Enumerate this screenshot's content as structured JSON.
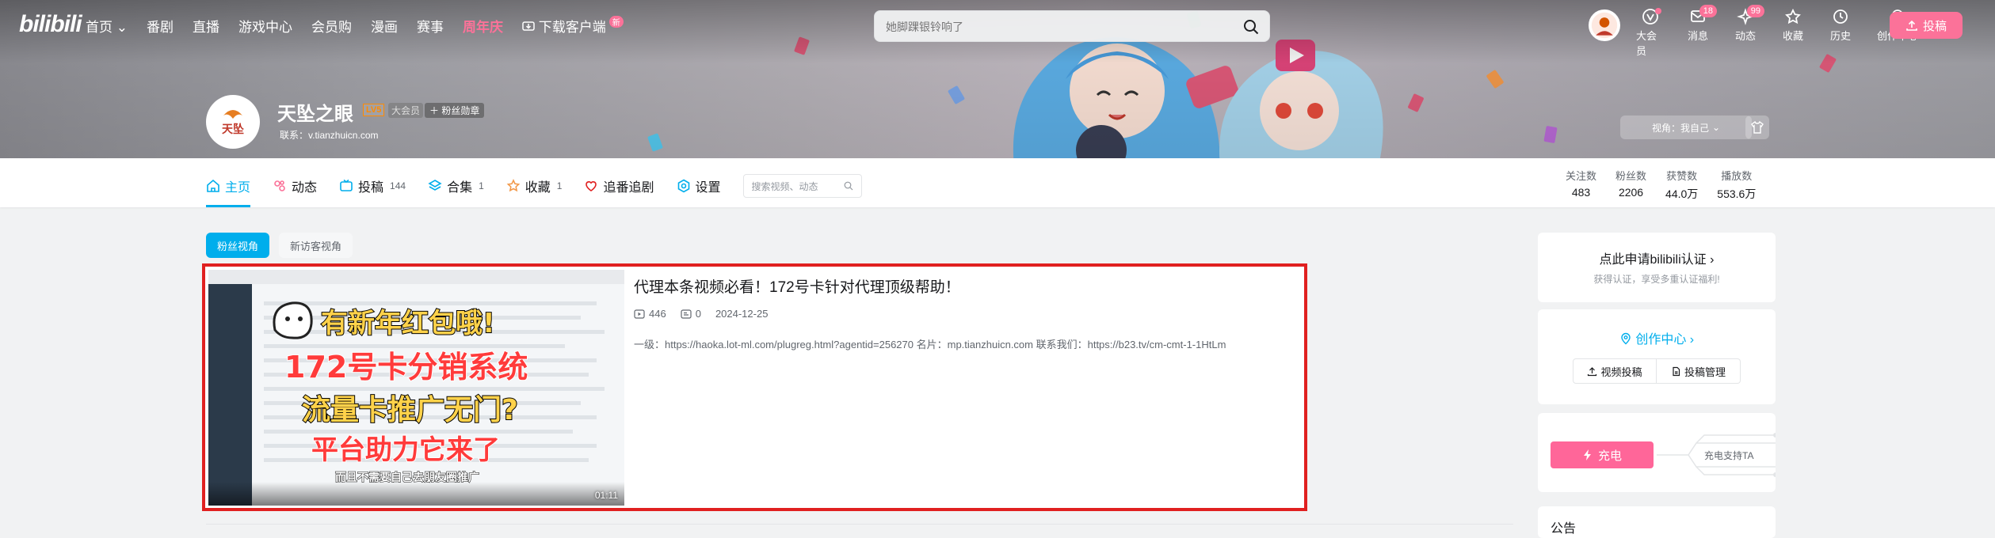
{
  "nav": {
    "logo": "bilibili",
    "items": [
      "首页",
      "番剧",
      "直播",
      "游戏中心",
      "会员购",
      "漫画",
      "赛事"
    ],
    "highlight": "周年庆",
    "download": "下载客户端",
    "download_badge": "新",
    "search_placeholder": "她脚踝银铃响了",
    "right": [
      {
        "label": "大会员",
        "icon": "vip-icon"
      },
      {
        "label": "消息",
        "icon": "message-icon",
        "badge": "18"
      },
      {
        "label": "动态",
        "icon": "dynamic-icon",
        "badge": "99"
      },
      {
        "label": "收藏",
        "icon": "star-icon"
      },
      {
        "label": "历史",
        "icon": "history-icon"
      },
      {
        "label": "创作中心",
        "icon": "bulb-icon"
      }
    ],
    "upload": "投稿"
  },
  "profile": {
    "avatar_text": "天坠",
    "name": "天坠之眼",
    "level": "LV5",
    "vip": "大会员",
    "fans_medal": "粉丝勋章",
    "sign": "联系：v.tianzhuicn.com",
    "view_as": "视角：我自己"
  },
  "tabs": [
    {
      "label": "主页",
      "count": "",
      "icon": "home-icon"
    },
    {
      "label": "动态",
      "count": "",
      "icon": "dynamic-icon"
    },
    {
      "label": "投稿",
      "count": "144",
      "icon": "tv-icon"
    },
    {
      "label": "合集",
      "count": "1",
      "icon": "layers-icon"
    },
    {
      "label": "收藏",
      "count": "1",
      "icon": "star-icon"
    },
    {
      "label": "追番追剧",
      "count": "",
      "icon": "heart-icon"
    },
    {
      "label": "设置",
      "count": "",
      "icon": "settings-icon"
    }
  ],
  "tab_search_placeholder": "搜索视频、动态",
  "stats": [
    {
      "label": "关注数",
      "value": "483"
    },
    {
      "label": "粉丝数",
      "value": "2206"
    },
    {
      "label": "获赞数",
      "value": "44.0万"
    },
    {
      "label": "播放数",
      "value": "553.6万"
    }
  ],
  "view_tabs": [
    "粉丝视角",
    "新访客视角"
  ],
  "video": {
    "title": "代理本条视频必看！172号卡针对代理顶级帮助！",
    "plays": "446",
    "danmaku": "0",
    "date": "2024-12-25",
    "desc": "一级：https://haoka.lot-ml.com/plugreg.html?agentid=256270 名片：mp.tianzhuicn.com  联系我们：https://b23.tv/cm-cmt-1-1HtLm",
    "duration": "01:11",
    "thumb_lines": [
      "有新年红包哦!",
      "172号卡分销系统",
      "流量卡推广无门?",
      "平台助力它来了",
      "而且不需要自己去朋友圈推广"
    ]
  },
  "sidebar": {
    "cert_title": "点此申请bilibili认证",
    "cert_sub": "获得认证，享受多重认证福利!",
    "creator_title": "创作中心",
    "creator_btn1": "视频投稿",
    "creator_btn2": "投稿管理",
    "charge_btn": "充电",
    "charge_tip": "充电支持TA",
    "notice_title": "公告"
  },
  "colors": {
    "accent": "#00aeec",
    "pink": "#fb7299",
    "highlight_border": "#e02020"
  }
}
